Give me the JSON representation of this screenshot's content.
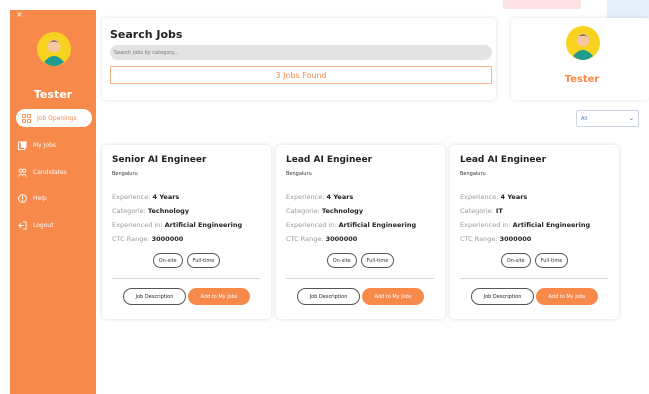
{
  "sidebar": {
    "close_label": "×",
    "user_name": "Tester",
    "items": [
      {
        "label": "Job Openings",
        "icon": "grid-icon",
        "active": true
      },
      {
        "label": "My Jobs",
        "icon": "briefcase-icon",
        "active": false
      },
      {
        "label": "Candidates",
        "icon": "users-icon",
        "active": false
      },
      {
        "label": "Help",
        "icon": "info-icon",
        "active": false
      },
      {
        "label": "Logout",
        "icon": "logout-icon",
        "active": false
      }
    ]
  },
  "search": {
    "title": "Search Jobs",
    "placeholder": "Search jobs by category...",
    "results_text": "3 Jobs Found"
  },
  "profile": {
    "name": "Tester"
  },
  "filter": {
    "selected": "All"
  },
  "jobs": [
    {
      "title": "Senior AI Engineer",
      "location": "Bengaluru",
      "experience_label": "Experience:",
      "experience": "4 Years",
      "category_label": "Categorie:",
      "category": "Technology",
      "experienced_in_label": "Experienced in:",
      "experienced_in": "Artificial Engineering",
      "ctc_label": "CTC Range:",
      "ctc": "3000000",
      "tag1": "On-site",
      "tag2": "Full-time",
      "desc_button": "Job Description",
      "add_button": "Add to My Jobs"
    },
    {
      "title": "Lead AI Engineer",
      "location": "Bengaluru",
      "experience_label": "Experience:",
      "experience": "4 Years",
      "category_label": "Categorie:",
      "category": "Technology",
      "experienced_in_label": "Experienced in:",
      "experienced_in": "Artificial Engineering",
      "ctc_label": "CTC Range:",
      "ctc": "3000000",
      "tag1": "On-site",
      "tag2": "Full-time",
      "desc_button": "Job Description",
      "add_button": "Add to My Jobs"
    },
    {
      "title": "Lead AI Engineer",
      "location": "Bengaluru",
      "experience_label": "Experience:",
      "experience": "4 Years",
      "category_label": "Categorie:",
      "category": "IT",
      "experienced_in_label": "Experienced in:",
      "experienced_in": "Artificial Engineering",
      "ctc_label": "CTC Range:",
      "ctc": "3000000",
      "tag1": "On-site",
      "tag2": "Full-time",
      "desc_button": "Job Description",
      "add_button": "Add to My Jobs"
    }
  ],
  "colors": {
    "accent": "#f7894a",
    "avatar_yellow": "#f7d21e",
    "avatar_teal": "#1f9b8f"
  }
}
